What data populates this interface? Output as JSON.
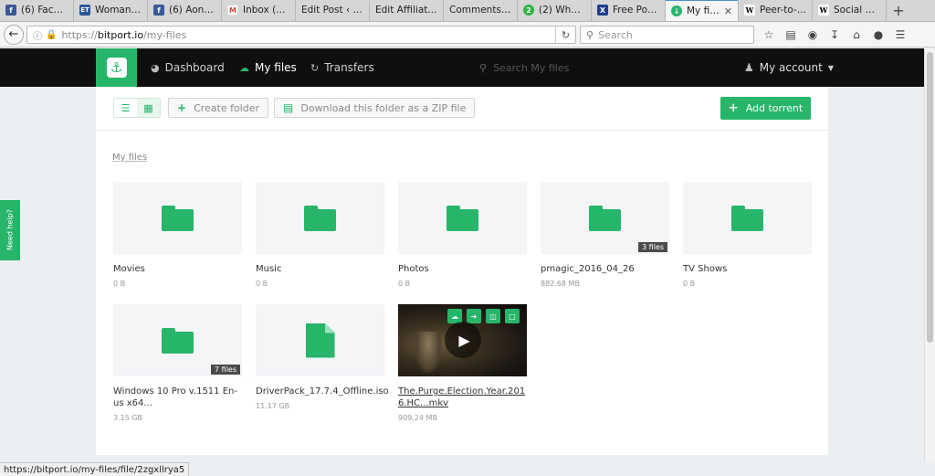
{
  "browser": {
    "tabs": [
      {
        "label": "(6) Face...",
        "icon": "facebook-icon",
        "color": "#3b5998",
        "glyph": "f"
      },
      {
        "label": "Woman ...",
        "icon": "et-icon",
        "color": "#2b5797",
        "glyph": "ET"
      },
      {
        "label": "(6) Aonk...",
        "icon": "facebook-icon",
        "color": "#3b5998",
        "glyph": "f"
      },
      {
        "label": "Inbox (1...",
        "icon": "gmail-icon",
        "color": "#d44638",
        "glyph": "M"
      },
      {
        "label": "Edit Post ‹ ...",
        "icon": "",
        "color": "",
        "glyph": ""
      },
      {
        "label": "Edit Affiliat...",
        "icon": "",
        "color": "",
        "glyph": ""
      },
      {
        "label": "Comments ...",
        "icon": "",
        "color": "",
        "glyph": ""
      },
      {
        "label": "(2) Wha...",
        "icon": "whatsapp-icon",
        "color": "#2bb741",
        "glyph": "2"
      },
      {
        "label": "Free Por...",
        "icon": "portal-icon",
        "color": "#1e3d8f",
        "glyph": "X"
      },
      {
        "label": "My fil...",
        "icon": "bitport-icon",
        "color": "#27b56a",
        "glyph": "↓",
        "active": true
      },
      {
        "label": "Peer-to-...",
        "icon": "wikipedia-icon",
        "color": "#ffffff",
        "glyph": "W"
      },
      {
        "label": "Social p...",
        "icon": "wikipedia-icon",
        "color": "#ffffff",
        "glyph": "W"
      }
    ],
    "url_protocol": "https://",
    "url_host": "bitport.io",
    "url_path": "/my-files",
    "search_placeholder": "Search",
    "status_url": "https://bitport.io/my-files/file/2zgxllrya5"
  },
  "app": {
    "nav": {
      "dashboard": "Dashboard",
      "my_files": "My files",
      "transfers": "Transfers"
    },
    "search_placeholder": "Search My files",
    "account": "My account",
    "toolbar": {
      "create_folder": "Create folder",
      "download_zip": "Download this folder as a ZIP file",
      "add_torrent": "Add torrent"
    },
    "breadcrumb": "My files",
    "feedback": "Need help?",
    "accent": "#27b56a",
    "items": [
      {
        "type": "folder",
        "name": "Movies",
        "size": "0 B"
      },
      {
        "type": "folder",
        "name": "Music",
        "size": "0 B"
      },
      {
        "type": "folder",
        "name": "Photos",
        "size": "0 B"
      },
      {
        "type": "folder",
        "name": "pmagic_2016_04_26",
        "size": "882.68 MB",
        "badge": "3 files"
      },
      {
        "type": "folder",
        "name": "TV Shows",
        "size": "0 B"
      },
      {
        "type": "folder",
        "name": "Windows 10 Pro v.1511 En-us x64...",
        "size": "3.15 GB",
        "badge": "7 files"
      },
      {
        "type": "file",
        "name": "DriverPack_17.7.4_Offline.iso",
        "size": "11.17 GB"
      },
      {
        "type": "video",
        "name": "The.Purge.Election.Year.2016.HC...mkv",
        "size": "909.24 MB"
      }
    ]
  }
}
